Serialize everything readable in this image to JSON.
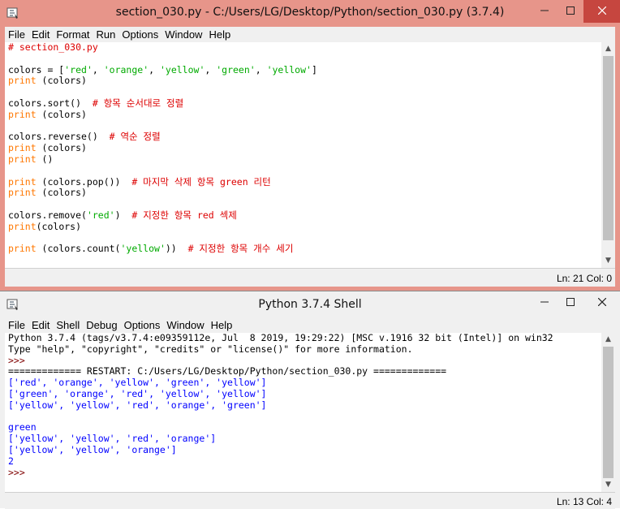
{
  "editor_window": {
    "title": "section_030.py - C:/Users/LG/Desktop/Python/section_030.py (3.7.4)",
    "menu": [
      "File",
      "Edit",
      "Format",
      "Run",
      "Options",
      "Window",
      "Help"
    ],
    "status": "Ln: 21  Col: 0",
    "code": {
      "l1": "# section_030.py",
      "l3a": "colors = [",
      "s_red": "'red'",
      "s_orange": "'orange'",
      "s_yellow": "'yellow'",
      "s_green": "'green'",
      "comma": ", ",
      "l3z": "]",
      "print": "print",
      "args_colors": " (colors)",
      "l6a": "colors.sort()  ",
      "c6": "# 항목 순서대로 정렬",
      "l9a": "colors.reverse()  ",
      "c9": "# 역순 정렬",
      "args_empty": " ()",
      "l13a": " (colors.pop())  ",
      "c13": "# 마지막 삭제 항목 green 리턴",
      "l16a": "colors.remove(",
      "l16b": ")  ",
      "c16": "# 지정한 항목 red 섹제",
      "args_colors2": "(colors)",
      "l19a": " (colors.count(",
      "l19b": "))  ",
      "c19": "# 지정한 항목 개수 세기"
    }
  },
  "shell_window": {
    "title": "Python 3.7.4 Shell",
    "menu": [
      "File",
      "Edit",
      "Shell",
      "Debug",
      "Options",
      "Window",
      "Help"
    ],
    "status": "Ln: 13  Col: 4",
    "output": {
      "banner1": "Python 3.7.4 (tags/v3.7.4:e09359112e, Jul  8 2019, 19:29:22) [MSC v.1916 32 bit (Intel)] on win32",
      "banner2": "Type \"help\", \"copyright\", \"credits\" or \"license()\" for more information.",
      "prompt": ">>> ",
      "restart": "============= RESTART: C:/Users/LG/Desktop/Python/section_030.py =============",
      "out1": "['red', 'orange', 'yellow', 'green', 'yellow']",
      "out2": "['green', 'orange', 'red', 'yellow', 'yellow']",
      "out3": "['yellow', 'yellow', 'red', 'orange', 'green']",
      "out4": "green",
      "out5": "['yellow', 'yellow', 'red', 'orange']",
      "out6": "['yellow', 'yellow', 'orange']",
      "out7": "2"
    }
  },
  "colors": {
    "editor_titlebar": "#e7958a",
    "close_button": "#c6463f",
    "keyword": "#ff7700",
    "string": "#00aa00",
    "comment": "#dd0000",
    "output": "#0000ff"
  },
  "icons": [
    "python-idle-icon",
    "minimize-icon",
    "maximize-icon",
    "close-icon"
  ]
}
